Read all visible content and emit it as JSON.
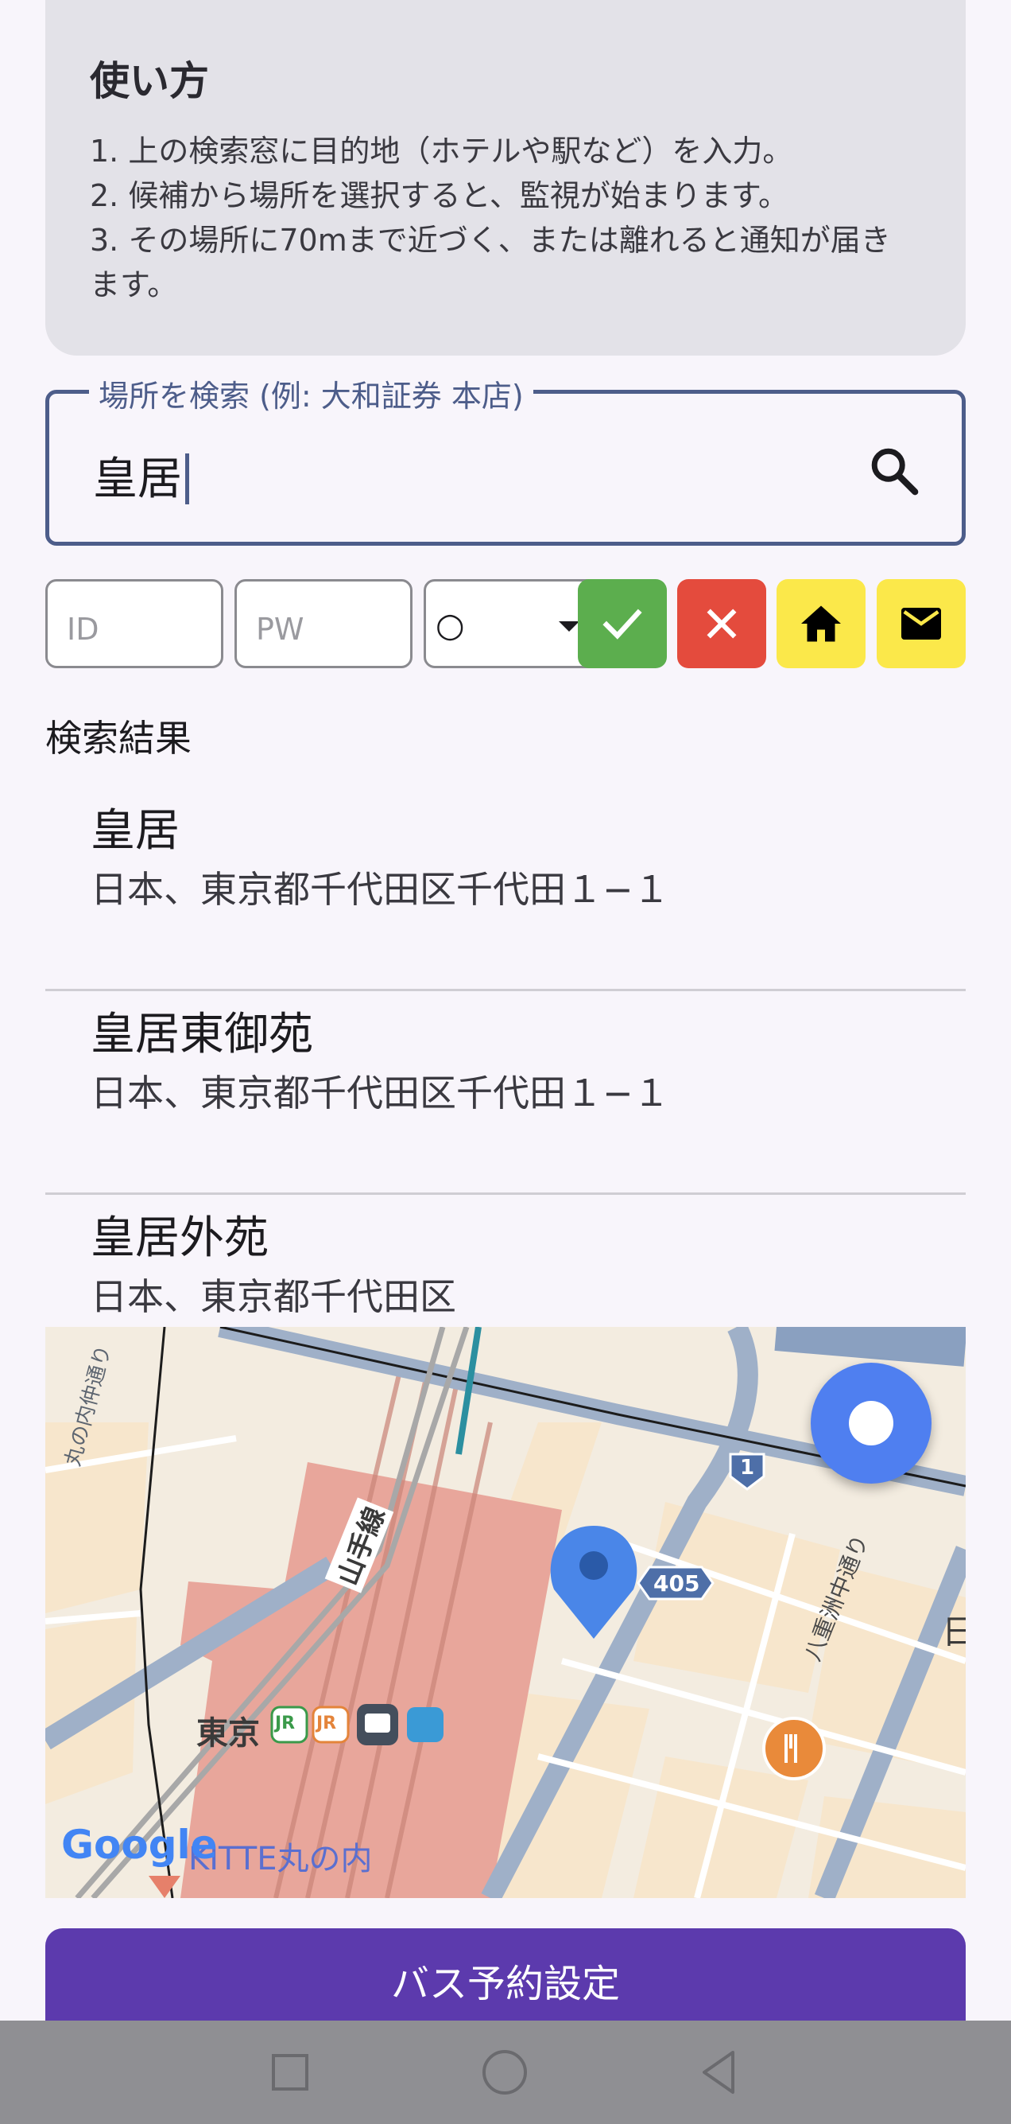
{
  "howto": {
    "title": "使い方",
    "steps": [
      "1. 上の検索窓に目的地（ホテルや駅など）を入力。",
      "2. 候補から場所を選択すると、監視が始まります。",
      "3. その場所に70mまで近づく、または離れると通知が届きます。"
    ]
  },
  "search": {
    "label": "場所を検索 (例: 大和証券 本店)",
    "value": "皇居",
    "icon": "search-icon"
  },
  "controls": {
    "id_placeholder": "ID",
    "pw_placeholder": "PW",
    "select_value": "○",
    "buttons": [
      {
        "name": "confirm-button",
        "icon": "check-icon",
        "color": "#5cae4e"
      },
      {
        "name": "cancel-button",
        "icon": "close-icon",
        "color": "#e44b3d"
      },
      {
        "name": "home-button",
        "icon": "home-icon",
        "color": "#fbe84a"
      },
      {
        "name": "mail-button",
        "icon": "mail-icon",
        "color": "#fbe84a"
      }
    ]
  },
  "results": {
    "heading": "検索結果",
    "items": [
      {
        "name": "皇居",
        "address": "日本、東京都千代田区千代田１−１"
      },
      {
        "name": "皇居東御苑",
        "address": "日本、東京都千代田区千代田１−１"
      },
      {
        "name": "皇居外苑",
        "address": "日本、東京都千代田区"
      }
    ]
  },
  "map": {
    "labels": {
      "station": "東京",
      "line": "山手線",
      "street_left": "丸の内仲通り",
      "street_right": "八重洲中通り",
      "landmark": "KITTE丸の内",
      "route_1": "1",
      "route_405": "405",
      "edge_char": "日",
      "logo": "Google",
      "jr1": "JR",
      "jr2": "JR"
    },
    "location_button_icon": "my-location-icon"
  },
  "bus_button": {
    "label": "バス予約設定"
  },
  "navbar": {
    "icons": [
      "recents-icon",
      "home-circle-icon",
      "back-icon"
    ]
  }
}
